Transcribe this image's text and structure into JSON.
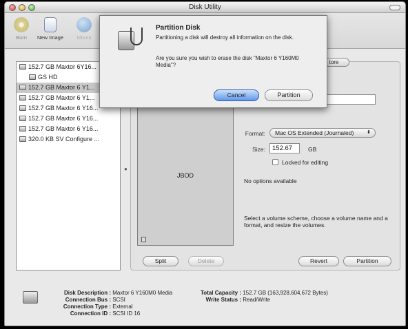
{
  "window": {
    "title": "Disk Utility"
  },
  "toolbar": {
    "burn_label": "Burn",
    "new_image_label": "New Image",
    "mount_label": "Mount"
  },
  "sidebar": {
    "items": [
      {
        "label": "152.7 GB Maxtor 6Y16..."
      },
      {
        "label": "GS HD"
      },
      {
        "label": "152.7 GB Maxtor 6 Y1..."
      },
      {
        "label": "152.7 GB Maxtor 6 Y1..."
      },
      {
        "label": "152.7 GB Maxtor 6 Y16..."
      },
      {
        "label": "152.7 GB Maxtor 6 Y16..."
      },
      {
        "label": "152.7 GB Maxtor 6 Y16..."
      },
      {
        "label": "320.0 KB SV Configure ..."
      }
    ]
  },
  "tabs": {
    "restore_label": "tore"
  },
  "volume": {
    "scheme_label": "JBOD"
  },
  "form": {
    "name_value": "",
    "format_label": "Format:",
    "format_value": "Mac OS Extended (Journaled)",
    "size_label": "Size:",
    "size_value": "152.67",
    "size_unit": "GB",
    "locked_label": "Locked for editing",
    "no_options": "No options available",
    "help_text": "Select a volume scheme, choose a volume name and a format, and resize the volumes."
  },
  "buttons": {
    "split": "Split",
    "delete": "Delete",
    "revert": "Revert",
    "partition": "Partition"
  },
  "info": {
    "left": [
      {
        "key": "Disk Description :",
        "value": "Maxtor 6 Y160M0 Media"
      },
      {
        "key": "Connection Bus :",
        "value": "SCSI"
      },
      {
        "key": "Connection Type :",
        "value": "External"
      },
      {
        "key": "Connection ID :",
        "value": "SCSI ID 16"
      }
    ],
    "right": [
      {
        "key": "Total Capacity :",
        "value": "152.7 GB (163,928,604,672 Bytes)"
      },
      {
        "key": "Write Status :",
        "value": "Read/Write"
      }
    ]
  },
  "sheet": {
    "title": "Partition Disk",
    "message1": "Partitioning a disk will destroy all information on the disk.",
    "message2": "Are you sure you wish to erase the disk \"Maxtor 6 Y160M0 Media\"?",
    "cancel_label": "Cancel",
    "partition_label": "Partition"
  },
  "colors": {
    "default_button": "#5f99e9",
    "window_bg": "#e9e9e9"
  }
}
